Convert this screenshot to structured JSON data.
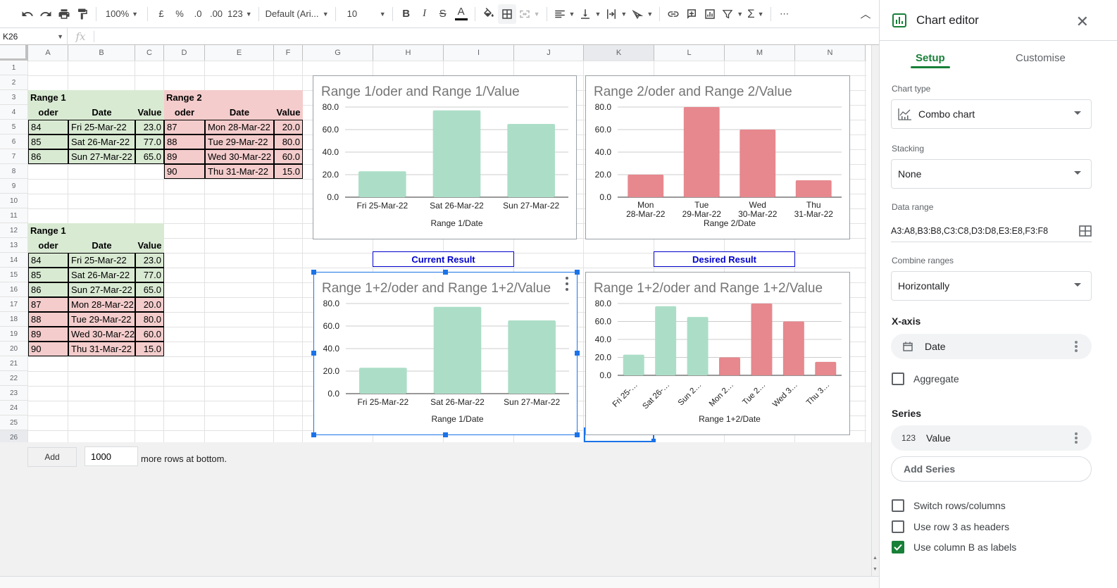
{
  "toolbar": {
    "zoom": "100%",
    "currency": "£",
    "percent": "%",
    "decrease_decimals": ".0",
    "increase_decimals": ".00",
    "more_formats": "123",
    "font": "Default (Ari...",
    "font_size": "10",
    "bold": "B",
    "italic": "I",
    "strike": "S",
    "text_color": "A",
    "more": "⋯"
  },
  "formula_bar": {
    "name_box": "K26",
    "fx": "fx",
    "formula": ""
  },
  "columns": [
    "A",
    "B",
    "C",
    "D",
    "E",
    "F",
    "G",
    "H",
    "I",
    "J",
    "K",
    "L",
    "M",
    "N"
  ],
  "selected_column": "K",
  "rows": [
    1,
    2,
    3,
    4,
    5,
    6,
    7,
    8,
    9,
    10,
    11,
    12,
    13,
    14,
    15,
    16,
    17,
    18,
    19,
    20,
    21,
    22,
    23,
    24,
    25,
    26
  ],
  "selected_row": 26,
  "table1": {
    "title": "Range 1",
    "headers": [
      "oder",
      "Date",
      "Value"
    ],
    "rows": [
      [
        "84",
        "Fri 25-Mar-22",
        "23.0"
      ],
      [
        "85",
        "Sat 26-Mar-22",
        "77.0"
      ],
      [
        "86",
        "Sun 27-Mar-22",
        "65.0"
      ]
    ]
  },
  "table2": {
    "title": "Range 2",
    "headers": [
      "oder",
      "Date",
      "Value"
    ],
    "rows": [
      [
        "87",
        "Mon 28-Mar-22",
        "20.0"
      ],
      [
        "88",
        "Tue 29-Mar-22",
        "80.0"
      ],
      [
        "89",
        "Wed 30-Mar-22",
        "60.0"
      ],
      [
        "90",
        "Thu 31-Mar-22",
        "15.0"
      ]
    ]
  },
  "table3": {
    "title": "Range 1",
    "headers": [
      "oder",
      "Date",
      "Value"
    ],
    "rows": [
      [
        "84",
        "Fri 25-Mar-22",
        "23.0"
      ],
      [
        "85",
        "Sat 26-Mar-22",
        "77.0"
      ],
      [
        "86",
        "Sun 27-Mar-22",
        "65.0"
      ],
      [
        "87",
        "Mon 28-Mar-22",
        "20.0"
      ],
      [
        "88",
        "Tue 29-Mar-22",
        "80.0"
      ],
      [
        "89",
        "Wed 30-Mar-22",
        "60.0"
      ],
      [
        "90",
        "Thu 31-Mar-22",
        "15.0"
      ]
    ],
    "row_colors": [
      "green",
      "green",
      "green",
      "red",
      "red",
      "red",
      "red"
    ]
  },
  "labels": {
    "current": "Current Result",
    "desired": "Desired Result"
  },
  "colors": {
    "green_fill": "#d9ead3",
    "red_fill": "#f4cccc",
    "green_bar": "#acdec7",
    "red_bar": "#e6888e",
    "accent": "#1a73e8",
    "editor_green": "#188038",
    "label_blue": "#0000cc"
  },
  "chart_data": [
    {
      "type": "bar",
      "title": "Range 1/oder and Range 1/Value",
      "xlabel": "Range 1/Date",
      "ylabel": "",
      "categories": [
        "Fri 25-Mar-22",
        "Sat 26-Mar-22",
        "Sun 27-Mar-22"
      ],
      "values": [
        23,
        77,
        65
      ],
      "bar_colors": [
        "green",
        "green",
        "green"
      ],
      "yticks": [
        "0.0",
        "20.0",
        "40.0",
        "60.0",
        "80.0"
      ],
      "ylim": [
        0,
        80
      ],
      "grid": true,
      "legend": "none"
    },
    {
      "type": "bar",
      "title": "Range 2/oder and Range 2/Value",
      "xlabel": "Range 2/Date",
      "ylabel": "",
      "categories": [
        "Mon|28-Mar-22",
        "Tue|29-Mar-22",
        "Wed|30-Mar-22",
        "Thu|31-Mar-22"
      ],
      "values": [
        20,
        80,
        60,
        15
      ],
      "bar_colors": [
        "red",
        "red",
        "red",
        "red"
      ],
      "yticks": [
        "0.0",
        "20.0",
        "40.0",
        "60.0",
        "80.0"
      ],
      "ylim": [
        0,
        80
      ],
      "grid": true,
      "legend": "none"
    },
    {
      "type": "bar",
      "title": "Range 1+2/oder and Range 1+2/Value",
      "xlabel": "Range 1/Date",
      "ylabel": "",
      "categories": [
        "Fri 25-Mar-22",
        "Sat 26-Mar-22",
        "Sun 27-Mar-22"
      ],
      "values": [
        23,
        77,
        65
      ],
      "bar_colors": [
        "green",
        "green",
        "green"
      ],
      "yticks": [
        "0.0",
        "20.0",
        "40.0",
        "60.0",
        "80.0"
      ],
      "ylim": [
        0,
        80
      ],
      "grid": true,
      "legend": "none",
      "selected": true
    },
    {
      "type": "bar",
      "title": "Range 1+2/oder and Range 1+2/Value",
      "xlabel": "Range 1+2/Date",
      "ylabel": "",
      "categories": [
        "Fri 25-…",
        "Sat 26-…",
        "Sun 2…",
        "Mon 2…",
        "Tue 2…",
        "Wed 3…",
        "Thu 3…"
      ],
      "values": [
        23,
        77,
        65,
        20,
        80,
        60,
        15
      ],
      "bar_colors": [
        "green",
        "green",
        "green",
        "red",
        "red",
        "red",
        "red"
      ],
      "yticks": [
        "0.0",
        "20.0",
        "40.0",
        "60.0",
        "80.0"
      ],
      "ylim": [
        0,
        80
      ],
      "grid": true,
      "legend": "none",
      "rotated_labels": true
    }
  ],
  "bottom": {
    "add_button": "Add",
    "rows_value": "1000",
    "more_rows_text": "more rows at bottom."
  },
  "editor": {
    "title": "Chart editor",
    "tabs": [
      "Setup",
      "Customise"
    ],
    "active_tab": "Setup",
    "chart_type_label": "Chart type",
    "chart_type": "Combo chart",
    "stacking_label": "Stacking",
    "stacking": "None",
    "data_range_label": "Data range",
    "data_range": "A3:A8,B3:B8,C3:C8,D3:D8,E3:E8,F3:F8",
    "combine_label": "Combine ranges",
    "combine": "Horizontally",
    "xaxis_head": "X-axis",
    "xaxis_value": "Date",
    "aggregate": "Aggregate",
    "aggregate_checked": false,
    "series_head": "Series",
    "series_icon": "123",
    "series_value": "Value",
    "add_series": "Add Series",
    "options": [
      {
        "label": "Switch rows/columns",
        "checked": false
      },
      {
        "label": "Use row 3 as headers",
        "checked": false
      },
      {
        "label": "Use column B as labels",
        "checked": true
      }
    ]
  }
}
